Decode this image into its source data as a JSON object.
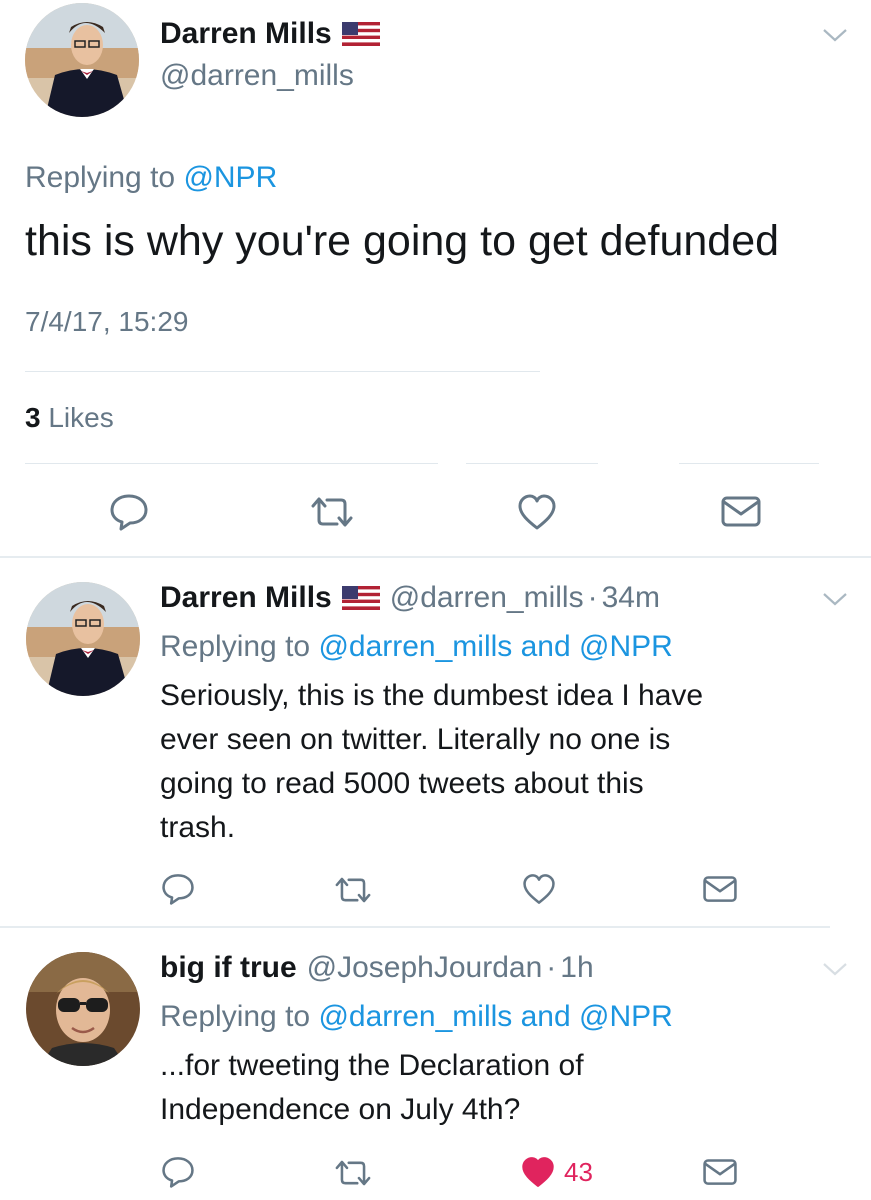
{
  "main_tweet": {
    "author_name": "Darren Mills",
    "author_flag": "us-flag-icon",
    "handle": "@darren_mills",
    "replying_prefix": "Replying to",
    "replying_to": "@NPR",
    "text": "this is why you're going to get defunded",
    "timestamp": "7/4/17, 15:29",
    "likes_count": "3",
    "likes_label": "Likes",
    "actions": [
      "reply-icon",
      "retweet-icon",
      "like-icon",
      "direct-message-icon"
    ]
  },
  "replies": [
    {
      "author_name": "Darren Mills",
      "author_flag": "us-flag-icon",
      "handle": "@darren_mills",
      "dot": "·",
      "time": "34m",
      "replying_prefix": "Replying to",
      "replying_to_1": "@darren_mills",
      "replying_and": "and",
      "replying_to_2": "@NPR",
      "text_lines": [
        "Seriously, this is the dumbest idea I have",
        "ever seen on twitter. Literally no one is",
        "going to read 5000 tweets about this",
        "trash."
      ]
    },
    {
      "author_name": "big if true",
      "handle": "@JosephJourdan",
      "dot": "·",
      "time": "1h",
      "replying_prefix": "Replying to",
      "replying_to_1": "@darren_mills",
      "replying_and": "and",
      "replying_to_2": "@NPR",
      "text_lines": [
        "...for tweeting the Declaration of",
        "Independence on July 4th?"
      ],
      "like_count": "43",
      "liked": true
    }
  ],
  "colors": {
    "link": "#1b95e0",
    "grey": "#657786",
    "like_active": "#e0245e",
    "text": "#14171a"
  }
}
